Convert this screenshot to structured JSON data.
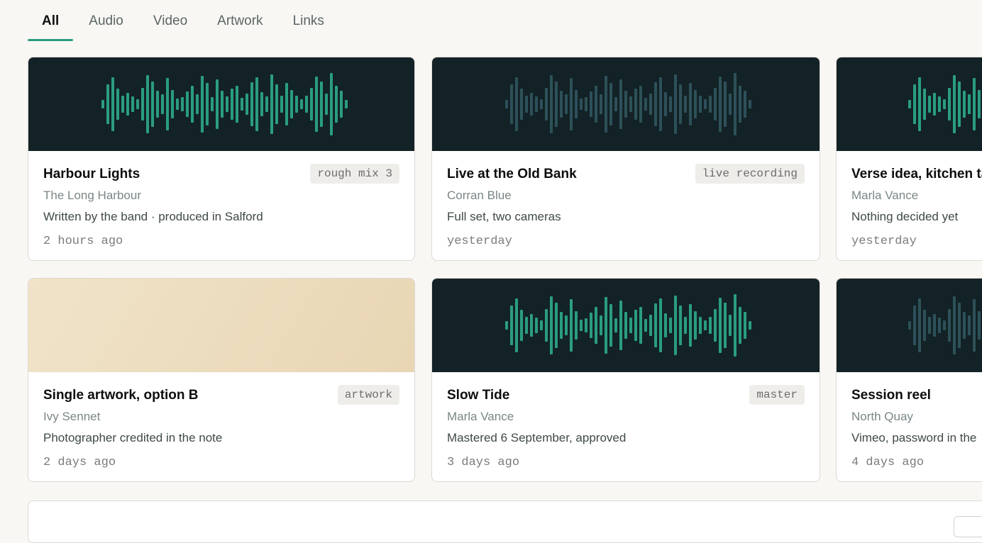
{
  "tabs": [
    {
      "label": "All",
      "active": true
    },
    {
      "label": "Audio",
      "active": false
    },
    {
      "label": "Video",
      "active": false
    },
    {
      "label": "Artwork",
      "active": false
    },
    {
      "label": "Links",
      "active": false
    }
  ],
  "colors": {
    "accent": "#2a9d80",
    "wave_active": "#2a9d80",
    "wave_dim": "#2d5159",
    "thumb_dark": "#132226"
  },
  "cards": [
    {
      "title": "Harbour Lights",
      "badge": "rough mix 3",
      "artist": "The Long Harbour",
      "note": "Written by the band · produced in Salford",
      "time": "2 hours ago",
      "thumb": "waveform",
      "wave_color": "active"
    },
    {
      "title": "Live at the Old Bank",
      "badge": "live recording",
      "artist": "Corran Blue",
      "note": "Full set, two cameras",
      "time": "yesterday",
      "thumb": "waveform",
      "wave_color": "dim"
    },
    {
      "title": "Verse idea, kitchen ta",
      "badge": "",
      "artist": "Marla Vance",
      "note": "Nothing decided yet",
      "time": "yesterday",
      "thumb": "waveform",
      "wave_color": "active"
    },
    {
      "title": "Single artwork, option B",
      "badge": "artwork",
      "artist": "Ivy Sennet",
      "note": "Photographer credited in the note",
      "time": "2 days ago",
      "thumb": "artwork",
      "wave_color": ""
    },
    {
      "title": "Slow Tide",
      "badge": "master",
      "artist": "Marla Vance",
      "note": "Mastered 6 September, approved",
      "time": "3 days ago",
      "thumb": "waveform",
      "wave_color": "active"
    },
    {
      "title": "Session reel",
      "badge": "",
      "artist": "North Quay",
      "note": "Vimeo, password in the",
      "time": "4 days ago",
      "thumb": "waveform",
      "wave_color": "dim"
    }
  ]
}
